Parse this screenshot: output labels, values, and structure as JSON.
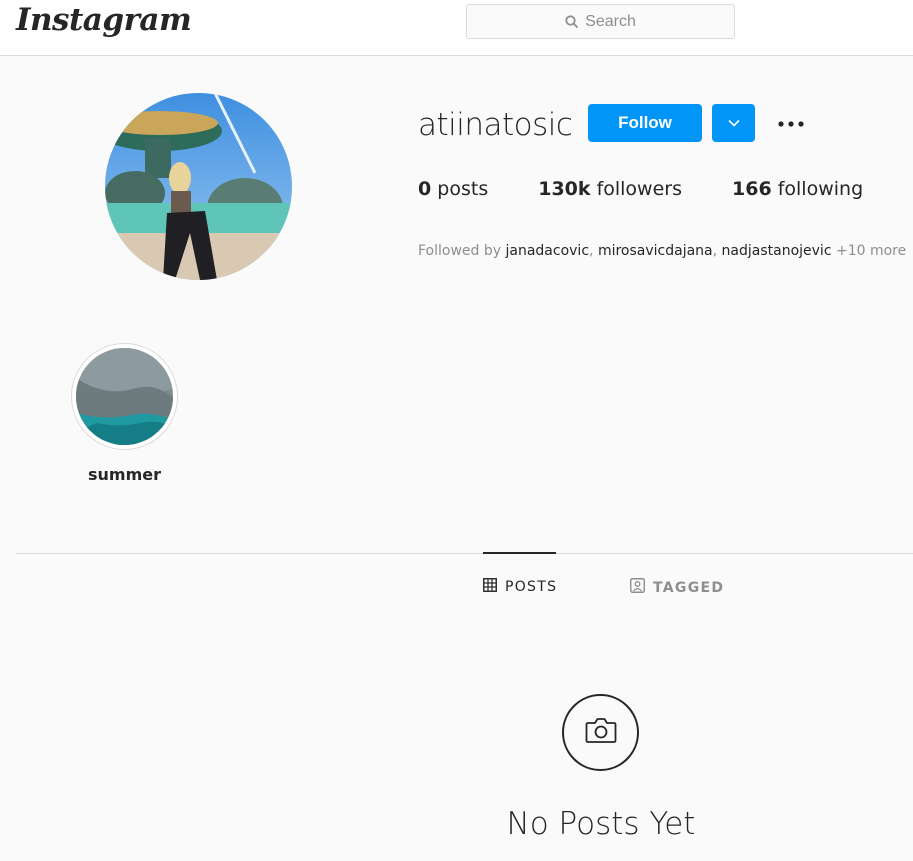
{
  "header": {
    "logo": "Instagram",
    "search_placeholder": "Search"
  },
  "profile": {
    "username": "atiinatosic",
    "follow_label": "Follow",
    "stats": {
      "posts_count": "0",
      "posts_label": "posts",
      "followers_count": "130k",
      "followers_label": "followers",
      "following_count": "166",
      "following_label": "following"
    },
    "followed_by": {
      "prefix": "Followed by",
      "names": [
        "janadacovic",
        "mirosavicdajana",
        "nadjastanojevic"
      ],
      "more": "+10 more"
    }
  },
  "highlights": [
    {
      "label": "summer"
    }
  ],
  "tabs": [
    {
      "label": "POSTS",
      "icon": "grid-icon",
      "active": true
    },
    {
      "label": "TAGGED",
      "icon": "tagged-icon",
      "active": false
    }
  ],
  "empty_state": {
    "icon": "camera-icon",
    "title": "No Posts Yet"
  },
  "colors": {
    "accent": "#0095f6",
    "background": "#fafafa",
    "border": "#dbdbdb",
    "text": "#262626",
    "muted": "#8e8e8e"
  }
}
